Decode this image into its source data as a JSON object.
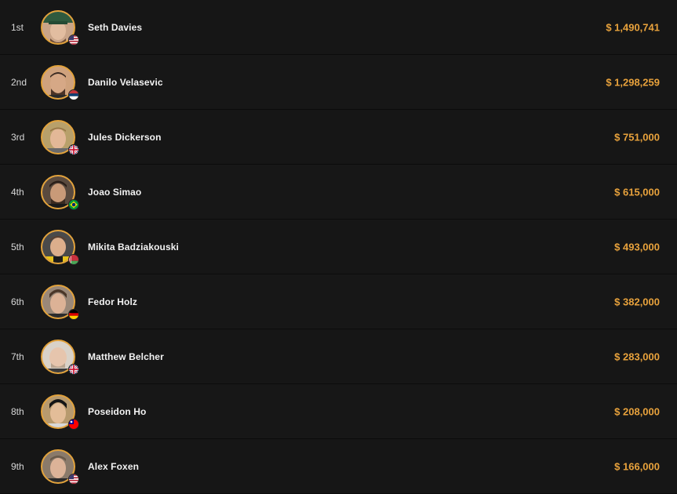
{
  "colors": {
    "background": "#141414",
    "accent": "#e8a23c",
    "text": "#f2f2f2"
  },
  "results": [
    {
      "place": "1st",
      "name": "Seth Davies",
      "prize": "$ 1,490,741",
      "flag": "us-flag-icon"
    },
    {
      "place": "2nd",
      "name": "Danilo Velasevic",
      "prize": "$ 1,298,259",
      "flag": "serbia-flag-icon"
    },
    {
      "place": "3rd",
      "name": "Jules Dickerson",
      "prize": "$ 751,000",
      "flag": "uk-flag-icon"
    },
    {
      "place": "4th",
      "name": "Joao Simao",
      "prize": "$ 615,000",
      "flag": "brazil-flag-icon"
    },
    {
      "place": "5th",
      "name": "Mikita Badziakouski",
      "prize": "$ 493,000",
      "flag": "belarus-flag-icon"
    },
    {
      "place": "6th",
      "name": "Fedor Holz",
      "prize": "$ 382,000",
      "flag": "germany-flag-icon"
    },
    {
      "place": "7th",
      "name": "Matthew Belcher",
      "prize": "$ 283,000",
      "flag": "uk-flag-icon"
    },
    {
      "place": "8th",
      "name": "Poseidon Ho",
      "prize": "$ 208,000",
      "flag": "taiwan-flag-icon"
    },
    {
      "place": "9th",
      "name": "Alex Foxen",
      "prize": "$ 166,000",
      "flag": "us-flag-icon"
    }
  ]
}
